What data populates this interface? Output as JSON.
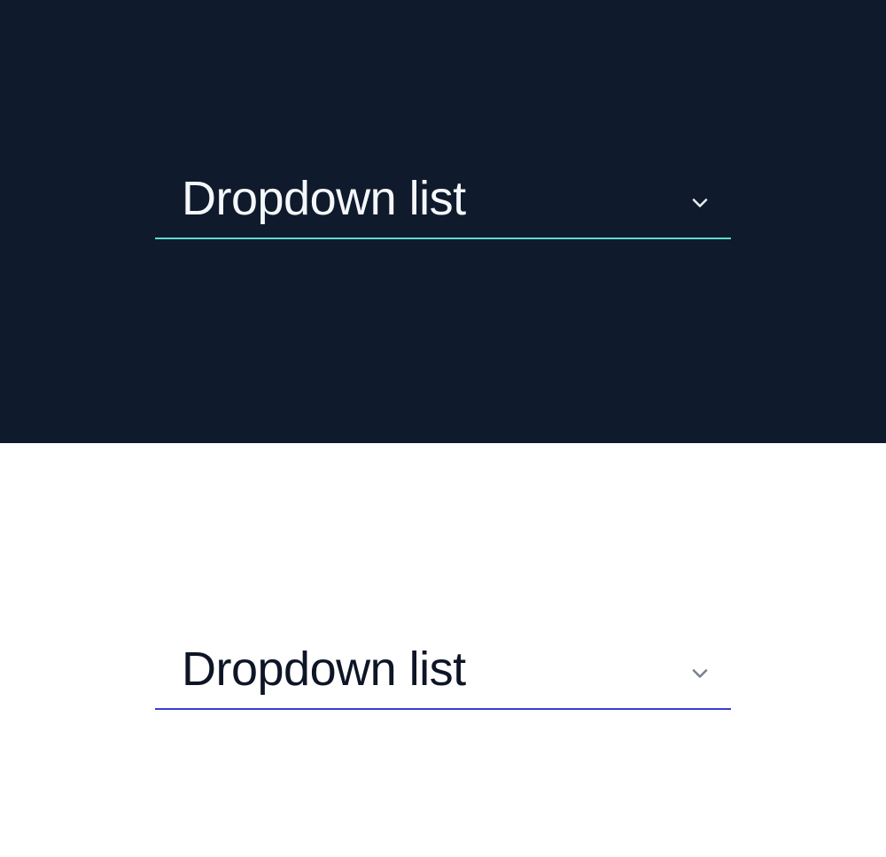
{
  "dark": {
    "dropdown": {
      "label": "Dropdown list",
      "underline_color": "#5fd9d1",
      "text_color": "#f5f7fa",
      "chevron_color": "#e8ecef",
      "background": "#0f1b2c"
    }
  },
  "light": {
    "dropdown": {
      "label": "Dropdown list",
      "underline_color": "#3b3dd1",
      "text_color": "#0e1526",
      "chevron_color": "#7a828c",
      "background": "#ffffff"
    }
  }
}
